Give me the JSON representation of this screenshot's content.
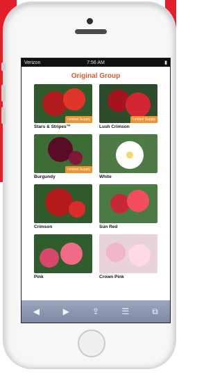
{
  "status_bar": {
    "carrier": "Verizon",
    "time": "7:56 AM",
    "battery": "battery-icon"
  },
  "page": {
    "group_title": "Original Group"
  },
  "products": [
    {
      "name": "Stars & Stripes™",
      "tag": "Limited Supply",
      "colors": [
        "#b21b1b",
        "#e2352a"
      ]
    },
    {
      "name": "Lush Crimson",
      "tag": "Limited Supply",
      "colors": [
        "#a6141f",
        "#d22632"
      ]
    },
    {
      "name": "Burgundy",
      "tag": "Limited Supply",
      "colors": [
        "#5a0b26",
        "#7f1737"
      ]
    },
    {
      "name": "White",
      "tag": "",
      "colors": [
        "#dedede",
        "#ffffff"
      ]
    },
    {
      "name": "Crimson",
      "tag": "",
      "colors": [
        "#b51a1a",
        "#db2b2b"
      ]
    },
    {
      "name": "Sun Red",
      "tag": "",
      "colors": [
        "#c8273a",
        "#f24d5e"
      ]
    },
    {
      "name": "Pink",
      "tag": "",
      "colors": [
        "#d9486a",
        "#f06c86"
      ]
    },
    {
      "name": "Crown Pink",
      "tag": "",
      "colors": [
        "#efb7c8",
        "#ffd9e5"
      ]
    }
  ],
  "toolbar": {
    "back": "◀",
    "forward": "▶",
    "share": "⇪",
    "bookmarks": "☰",
    "tabs": "⧉"
  }
}
